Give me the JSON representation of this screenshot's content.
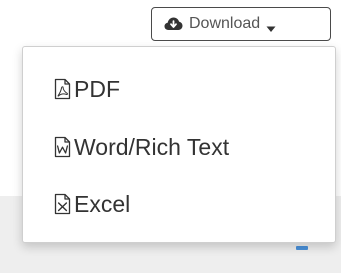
{
  "download_button": {
    "label": "Download",
    "icon": "cloud-download-icon",
    "caret_icon": "caret-down-icon"
  },
  "menu": {
    "items": [
      {
        "label": "PDF",
        "icon": "pdf-file-icon"
      },
      {
        "label": "Word/Rich Text",
        "icon": "word-file-icon"
      },
      {
        "label": "Excel",
        "icon": "excel-file-icon"
      }
    ]
  }
}
